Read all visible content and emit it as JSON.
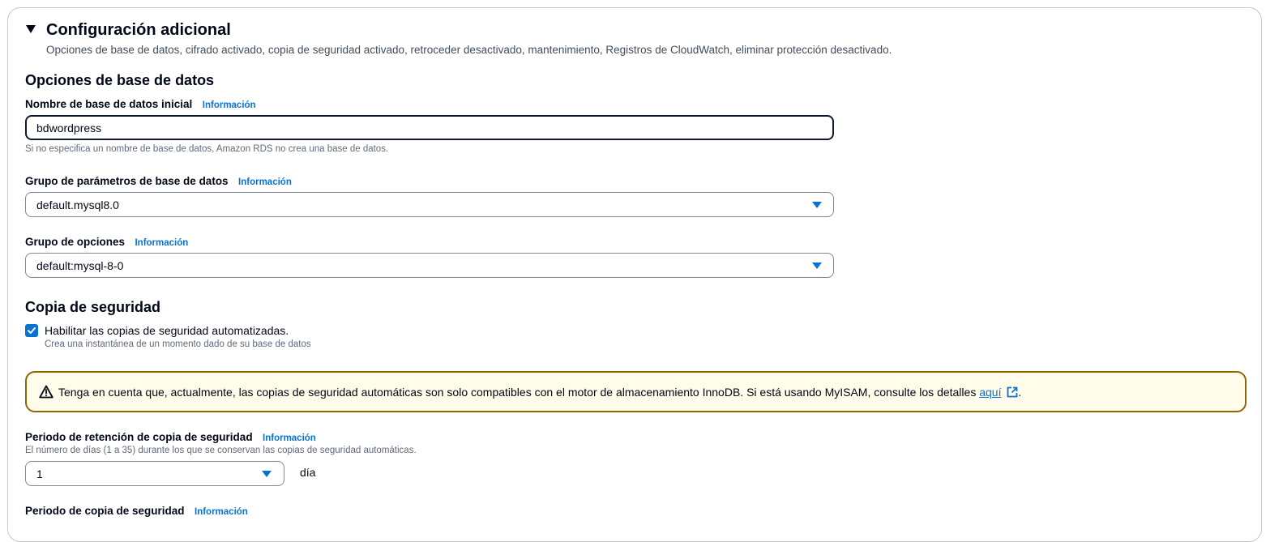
{
  "section": {
    "title": "Configuración adicional",
    "description": "Opciones de base de datos, cifrado activado, copia de seguridad activado, retroceder desactivado, mantenimiento, Registros de CloudWatch, eliminar protección desactivado."
  },
  "db_options": {
    "heading": "Opciones de base de datos",
    "initial_db": {
      "label": "Nombre de base de datos inicial",
      "info": "Información",
      "value": "bdwordpress",
      "hint": "Si no especifica un nombre de base de datos, Amazon RDS no crea una base de datos."
    },
    "param_group": {
      "label": "Grupo de parámetros de base de datos",
      "info": "Información",
      "value": "default.mysql8.0"
    },
    "option_group": {
      "label": "Grupo de opciones",
      "info": "Información",
      "value": "default:mysql-8-0"
    }
  },
  "backup": {
    "heading": "Copia de seguridad",
    "auto_backup": {
      "label": "Habilitar las copias de seguridad automatizadas.",
      "description": "Crea una instantánea de un momento dado de su base de datos",
      "checked": true
    },
    "warning": {
      "text": "Tenga en cuenta que, actualmente, las copias de seguridad automáticas son solo compatibles con el motor de almacenamiento InnoDB. Si está usando MyISAM, consulte los detalles ",
      "link": "aquí",
      "suffix": "."
    },
    "retention": {
      "label": "Periodo de retención de copia de seguridad",
      "info": "Información",
      "hint": "El número de días (1 a 35) durante los que se conservan las copias de seguridad automáticas.",
      "value": "1",
      "unit": "día"
    },
    "window": {
      "label": "Periodo de copia de seguridad",
      "info": "Información"
    }
  },
  "colors": {
    "link": "#0972d3",
    "warning_border": "#8d6605",
    "warning_bg": "#fffce9",
    "text": "#000716"
  }
}
